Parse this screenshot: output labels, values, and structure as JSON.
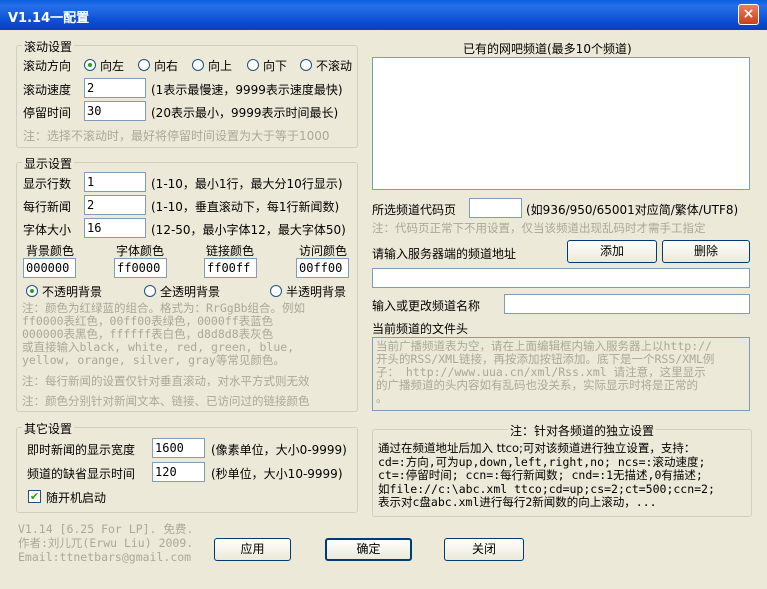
{
  "window": {
    "title": "V1.14一配置",
    "close_glyph": "×"
  },
  "scroll": {
    "legend": "滚动设置",
    "direction_label": "滚动方向",
    "directions": [
      "向左",
      "向右",
      "向上",
      "向下",
      "不滚动"
    ],
    "selected_direction": "向左",
    "speed_label": "滚动速度",
    "speed_value": "2",
    "speed_hint": "(1表示最慢速，9999表示速度最快)",
    "stay_label": "停留时间",
    "stay_value": "30",
    "stay_hint": "(20表示最小，9999表示时间最长)",
    "note": "注：选择不滚动时，最好将停留时间设置为大于等于1000"
  },
  "display": {
    "legend": "显示设置",
    "rows_label": "显示行数",
    "rows_value": "1",
    "rows_hint": "(1-10，最小1行，最大分10行显示)",
    "news_label": "每行新闻",
    "news_value": "2",
    "news_hint": "(1-10，垂直滚动下，每1行新闻数)",
    "font_label": "字体大小",
    "font_value": "16",
    "font_hint": "(12-50，最小字体12，最大字体50)",
    "bg_color_label": "背景颜色",
    "bg_color_value": "000000",
    "font_color_label": "字体颜色",
    "font_color_value": "ff0000",
    "link_color_label": "链接颜色",
    "link_color_value": "ff00ff",
    "visited_color_label": "访问颜色",
    "visited_color_value": "00ff00",
    "backgrounds": [
      "不透明背景",
      "全透明背景",
      "半透明背景"
    ],
    "selected_background": "不透明背景",
    "color_note_lines": [
      "注：颜色为红绿蓝的组合。格式为：RrGgBb组合。例如",
      "ff0000表红色，00ff00表绿色，0000ff表蓝色",
      "000000表黑色，ffffff表白色，d8d8d8表灰色",
      "或直接输入black, white, red, green, blue,",
      "yellow, orange, silver, gray等常见颜色。"
    ],
    "note2": "注：每行新闻的设置仅针对垂直滚动，对水平方式则无效",
    "note3": "注：颜色分别针对新闻文本、链接、已访问过的链接颜色"
  },
  "other": {
    "legend": "其它设置",
    "width_label": "即时新闻的显示宽度",
    "width_value": "1600",
    "width_hint": "(像素单位，大小0-9999)",
    "time_label": "频道的缺省显示时间",
    "time_value": "120",
    "time_hint": "(秒单位，大小10-9999)",
    "autostart_label": "随开机启动",
    "autostart_checked": true,
    "check_glyph": "✔"
  },
  "footer": {
    "info_lines": [
      "V1.14 [6.25 For LP]. 免费.",
      "作者:刘儿兀(Erwu Liu) 2009.",
      "Email:ttnetbars@gmail.com"
    ],
    "apply_label": "应用",
    "ok_label": "确定",
    "close_label": "关闭"
  },
  "channels": {
    "list_title": "已有的网吧频道(最多10个频道)",
    "codepage_label": "所选频道代码页",
    "codepage_value": "",
    "codepage_hint": "(如936/950/65001对应简/繁体/UTF8)",
    "codepage_note": "注：代码页正常下不用设置，仅当该频道出现乱码时才需手工指定",
    "url_label": "请输入服务器端的频道地址",
    "add_label": "添加",
    "delete_label": "删除",
    "url_value": "",
    "name_label": "输入或更改频道名称",
    "name_value": "",
    "header_label": "当前频道的文件头",
    "header_lines": [
      "当前广播频道表为空，请在上面编辑框内输入服务器上以http://",
      "开头的RSS/XML链接，再按添加按钮添加。底下是一个RSS/XML例",
      "子：    http://www.uua.cn/xml/Rss.xml  请注意，这里显示",
      "的广播频道的头内容如有乱码也没关系，实际显示时将是正常的",
      "。"
    ]
  },
  "independent": {
    "legend": "注：针对各频道的独立设置",
    "lines": [
      "通过在频道地址后加入 ttco;可对该频道进行独立设置，支持：",
      "cd=:方向,可为up,down,left,right,no; ncs=:滚动速度;",
      "ct=:停留时间;  ccn=:每行新闻数;  cnd=:1无描述,0有描述;",
      "如file://c:\\abc.xml ttco;cd=up;cs=2;ct=500;ccn=2;",
      "表示对c盘abc.xml进行每行2新闻数的向上滚动，..."
    ]
  }
}
